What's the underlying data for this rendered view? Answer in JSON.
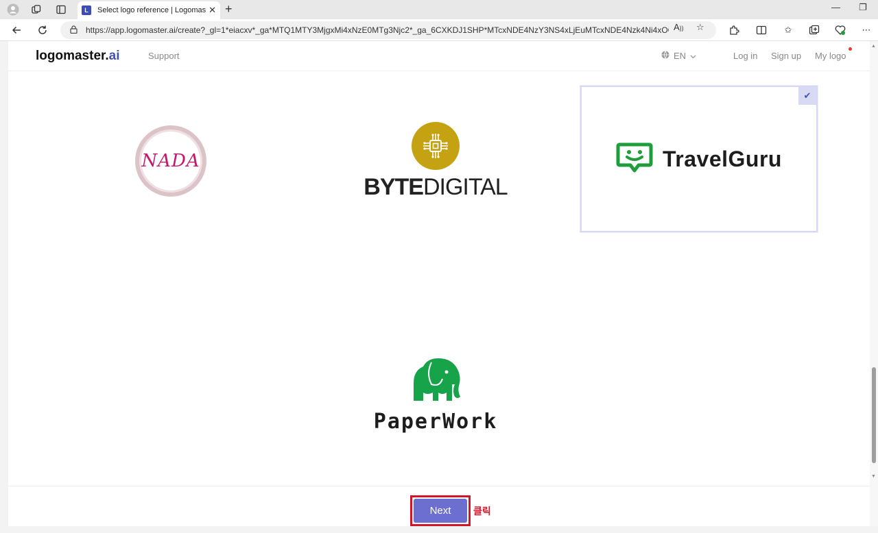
{
  "browser": {
    "tab_title": "Select logo reference | Logomaster",
    "tab_favicon": "L",
    "url": "https://app.logomaster.ai/create?_gl=1*eiacxv*_ga*MTQ1MTY3MjgxMi4xNzE0MTg3Njc2*_ga_6CXKDJ1SHP*MTcxNDE4NzY3NS4xLjEuMTcxNDE4Nzk4Ni4xOC4..."
  },
  "header": {
    "brand_main": "logomaster.",
    "brand_ai": "ai",
    "support": "Support",
    "lang": "EN",
    "login": "Log in",
    "signup": "Sign up",
    "mylogo": "My logo"
  },
  "logos": {
    "nada": "NADA",
    "byte_bold": "BYTE",
    "byte_light": "DIGITAL",
    "travelguru": "TravelGuru",
    "paperwork": "PaperWork"
  },
  "footer": {
    "next_label": "Next",
    "annotation": "클릭"
  },
  "colors": {
    "accent": "#6c6fd0",
    "brand_ai": "#3f51b5",
    "highlight": "#d3152a",
    "travelguru_green": "#1e9e3a",
    "paperwork_green": "#16a34a",
    "byte_gold": "#c4a212"
  }
}
